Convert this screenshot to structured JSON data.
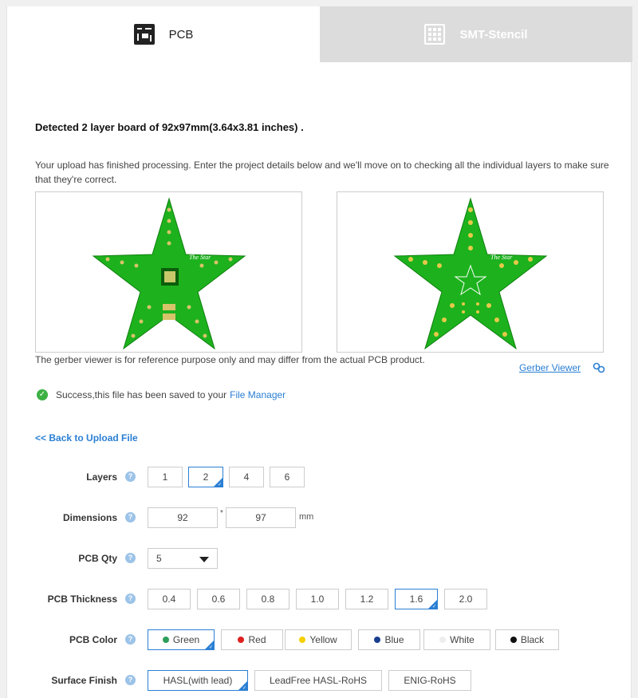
{
  "tabs": {
    "pcb": "PCB",
    "smt": "SMT-Stencil"
  },
  "header": {
    "title": "Detected 2 layer board of 92x97mm(3.64x3.81 inches) .",
    "description": "Your upload has finished processing. Enter the project details below and we'll move on to checking all the individual layers to make sure that they're correct."
  },
  "preview": {
    "note": "The gerber viewer is for reference purpose only and may differ from the actual PCB product.",
    "gerber_viewer": "Gerber Viewer",
    "board_text": "The Star"
  },
  "status": {
    "success": "Success,this file has been saved to your",
    "file_manager": "File Manager"
  },
  "back_link": "<< Back to Upload File",
  "form": {
    "layers": {
      "label": "Layers",
      "options": [
        "1",
        "2",
        "4",
        "6"
      ],
      "selected": "2"
    },
    "dimensions": {
      "label": "Dimensions",
      "width": "92",
      "sep": "*",
      "height": "97",
      "unit": "mm"
    },
    "qty": {
      "label": "PCB Qty",
      "value": "5"
    },
    "thickness": {
      "label": "PCB Thickness",
      "options": [
        "0.4",
        "0.6",
        "0.8",
        "1.0",
        "1.2",
        "1.6",
        "2.0"
      ],
      "selected": "1.6"
    },
    "color": {
      "label": "PCB Color",
      "options": [
        {
          "name": "Green",
          "hex": "#2e9e5b"
        },
        {
          "name": "Red",
          "hex": "#e02020"
        },
        {
          "name": "Yellow",
          "hex": "#f5d000"
        },
        {
          "name": "Blue",
          "hex": "#1a3f8f"
        },
        {
          "name": "White",
          "hex": "#eeeeee"
        },
        {
          "name": "Black",
          "hex": "#111111"
        }
      ],
      "selected": "Green"
    },
    "finish": {
      "label": "Surface Finish",
      "options": [
        "HASL(with lead)",
        "LeadFree HASL-RoHS",
        "ENIG-RoHS"
      ],
      "selected": "HASL(with lead)"
    }
  },
  "colors": {
    "accent": "#2a7fd4",
    "board": "#1db21d",
    "success": "#3cb043"
  }
}
